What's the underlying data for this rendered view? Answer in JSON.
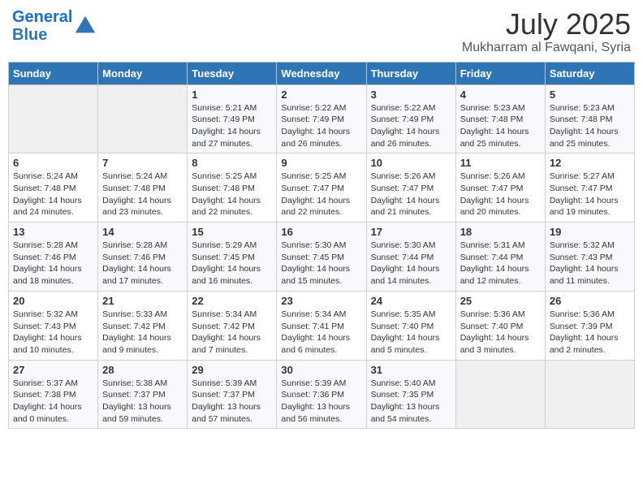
{
  "header": {
    "logo_line1": "General",
    "logo_line2": "Blue",
    "month_title": "July 2025",
    "subtitle": "Mukharram al Fawqani, Syria"
  },
  "days_of_week": [
    "Sunday",
    "Monday",
    "Tuesday",
    "Wednesday",
    "Thursday",
    "Friday",
    "Saturday"
  ],
  "weeks": [
    [
      {
        "num": "",
        "info": ""
      },
      {
        "num": "",
        "info": ""
      },
      {
        "num": "1",
        "info": "Sunrise: 5:21 AM\nSunset: 7:49 PM\nDaylight: 14 hours and 27 minutes."
      },
      {
        "num": "2",
        "info": "Sunrise: 5:22 AM\nSunset: 7:49 PM\nDaylight: 14 hours and 26 minutes."
      },
      {
        "num": "3",
        "info": "Sunrise: 5:22 AM\nSunset: 7:49 PM\nDaylight: 14 hours and 26 minutes."
      },
      {
        "num": "4",
        "info": "Sunrise: 5:23 AM\nSunset: 7:48 PM\nDaylight: 14 hours and 25 minutes."
      },
      {
        "num": "5",
        "info": "Sunrise: 5:23 AM\nSunset: 7:48 PM\nDaylight: 14 hours and 25 minutes."
      }
    ],
    [
      {
        "num": "6",
        "info": "Sunrise: 5:24 AM\nSunset: 7:48 PM\nDaylight: 14 hours and 24 minutes."
      },
      {
        "num": "7",
        "info": "Sunrise: 5:24 AM\nSunset: 7:48 PM\nDaylight: 14 hours and 23 minutes."
      },
      {
        "num": "8",
        "info": "Sunrise: 5:25 AM\nSunset: 7:48 PM\nDaylight: 14 hours and 22 minutes."
      },
      {
        "num": "9",
        "info": "Sunrise: 5:25 AM\nSunset: 7:47 PM\nDaylight: 14 hours and 22 minutes."
      },
      {
        "num": "10",
        "info": "Sunrise: 5:26 AM\nSunset: 7:47 PM\nDaylight: 14 hours and 21 minutes."
      },
      {
        "num": "11",
        "info": "Sunrise: 5:26 AM\nSunset: 7:47 PM\nDaylight: 14 hours and 20 minutes."
      },
      {
        "num": "12",
        "info": "Sunrise: 5:27 AM\nSunset: 7:47 PM\nDaylight: 14 hours and 19 minutes."
      }
    ],
    [
      {
        "num": "13",
        "info": "Sunrise: 5:28 AM\nSunset: 7:46 PM\nDaylight: 14 hours and 18 minutes."
      },
      {
        "num": "14",
        "info": "Sunrise: 5:28 AM\nSunset: 7:46 PM\nDaylight: 14 hours and 17 minutes."
      },
      {
        "num": "15",
        "info": "Sunrise: 5:29 AM\nSunset: 7:45 PM\nDaylight: 14 hours and 16 minutes."
      },
      {
        "num": "16",
        "info": "Sunrise: 5:30 AM\nSunset: 7:45 PM\nDaylight: 14 hours and 15 minutes."
      },
      {
        "num": "17",
        "info": "Sunrise: 5:30 AM\nSunset: 7:44 PM\nDaylight: 14 hours and 14 minutes."
      },
      {
        "num": "18",
        "info": "Sunrise: 5:31 AM\nSunset: 7:44 PM\nDaylight: 14 hours and 12 minutes."
      },
      {
        "num": "19",
        "info": "Sunrise: 5:32 AM\nSunset: 7:43 PM\nDaylight: 14 hours and 11 minutes."
      }
    ],
    [
      {
        "num": "20",
        "info": "Sunrise: 5:32 AM\nSunset: 7:43 PM\nDaylight: 14 hours and 10 minutes."
      },
      {
        "num": "21",
        "info": "Sunrise: 5:33 AM\nSunset: 7:42 PM\nDaylight: 14 hours and 9 minutes."
      },
      {
        "num": "22",
        "info": "Sunrise: 5:34 AM\nSunset: 7:42 PM\nDaylight: 14 hours and 7 minutes."
      },
      {
        "num": "23",
        "info": "Sunrise: 5:34 AM\nSunset: 7:41 PM\nDaylight: 14 hours and 6 minutes."
      },
      {
        "num": "24",
        "info": "Sunrise: 5:35 AM\nSunset: 7:40 PM\nDaylight: 14 hours and 5 minutes."
      },
      {
        "num": "25",
        "info": "Sunrise: 5:36 AM\nSunset: 7:40 PM\nDaylight: 14 hours and 3 minutes."
      },
      {
        "num": "26",
        "info": "Sunrise: 5:36 AM\nSunset: 7:39 PM\nDaylight: 14 hours and 2 minutes."
      }
    ],
    [
      {
        "num": "27",
        "info": "Sunrise: 5:37 AM\nSunset: 7:38 PM\nDaylight: 14 hours and 0 minutes."
      },
      {
        "num": "28",
        "info": "Sunrise: 5:38 AM\nSunset: 7:37 PM\nDaylight: 13 hours and 59 minutes."
      },
      {
        "num": "29",
        "info": "Sunrise: 5:39 AM\nSunset: 7:37 PM\nDaylight: 13 hours and 57 minutes."
      },
      {
        "num": "30",
        "info": "Sunrise: 5:39 AM\nSunset: 7:36 PM\nDaylight: 13 hours and 56 minutes."
      },
      {
        "num": "31",
        "info": "Sunrise: 5:40 AM\nSunset: 7:35 PM\nDaylight: 13 hours and 54 minutes."
      },
      {
        "num": "",
        "info": ""
      },
      {
        "num": "",
        "info": ""
      }
    ]
  ]
}
